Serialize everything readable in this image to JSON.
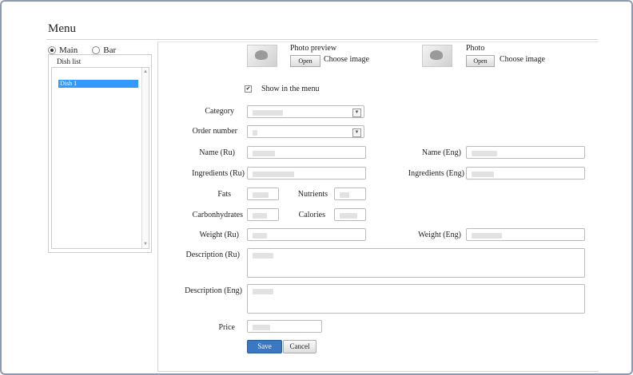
{
  "page": {
    "title": "Menu"
  },
  "left": {
    "radio_main": "Main",
    "radio_bar": "Bar",
    "dish_list_caption": "Dish list",
    "dishes": [
      "Dish 1"
    ]
  },
  "photos": {
    "preview_label": "Photo preview",
    "photo_label": "Photo",
    "open_label": "Open",
    "choose_label": "Choose image"
  },
  "form": {
    "show_in_menu": "Show in the menu",
    "category": "Category",
    "order_number": "Order number",
    "name_ru": "Name (Ru)",
    "name_eng": "Name (Eng)",
    "ingredients_ru": "Ingredients (Ru)",
    "ingredients_eng": "Ingredients (Eng)",
    "fats": "Fats",
    "nutrients": "Nutrients",
    "carbohydrates": "Carbonhydrates",
    "calories": "Calories",
    "weight_ru": "Weight (Ru)",
    "weight_eng": "Weight (Eng)",
    "description_ru": "Description (Ru)",
    "description_eng": "Description (Eng)",
    "price": "Price"
  },
  "actions": {
    "save": "Save",
    "cancel": "Cancel"
  }
}
